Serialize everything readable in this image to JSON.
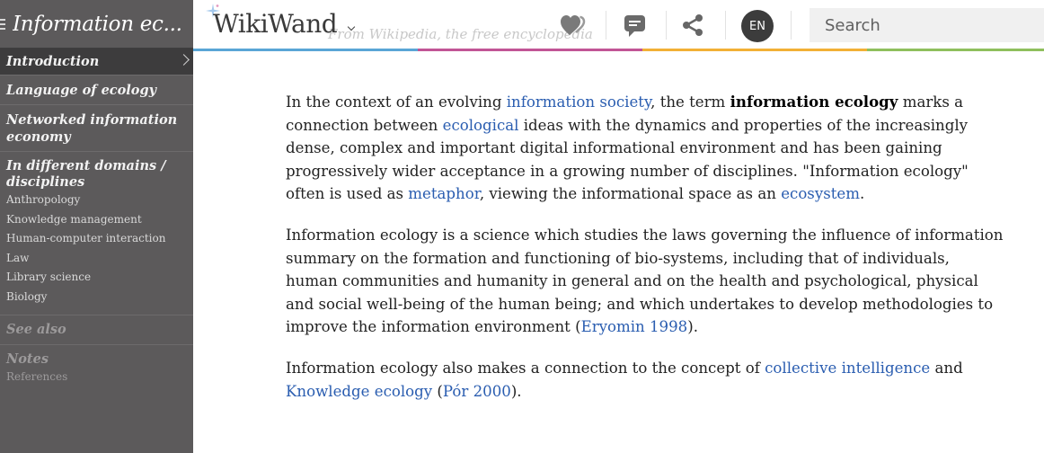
{
  "sidebar": {
    "title": "Information ec...",
    "active_item": "Introduction",
    "items": [
      "Language of ecology",
      "Networked information economy"
    ],
    "domains_section": {
      "heading": "In different domains / disciplines",
      "subitems": [
        "Anthropology",
        "Knowledge management",
        "Human-computer interaction",
        "Law",
        "Library science",
        "Biology"
      ]
    },
    "see_also": "See also",
    "notes": {
      "heading": "Notes",
      "subitems": [
        "References"
      ]
    }
  },
  "header": {
    "logo": "WikiWand",
    "tagline": "From Wikipedia, the free encyclopedia",
    "language": "EN",
    "search_placeholder": "Search",
    "icons": [
      "heart-icon",
      "comment-icon",
      "share-icon"
    ],
    "strip_colors": [
      "#5aa6d6",
      "#c15596",
      "#f2b036",
      "#8fbf5d"
    ]
  },
  "article": {
    "p1": {
      "t1": "In the context of an evolving ",
      "l1": "information society",
      "t2": ", the term ",
      "b1": "information ecology",
      "t3": " marks a connection between ",
      "l2": "ecological",
      "t4": " ideas with the dynamics and properties of the increasingly dense, complex and important digital informational environment and has been gaining progressively wider acceptance in a growing number of disciplines. \"Information ecology\" often is used as ",
      "l3": "metaphor",
      "t5": ", viewing the informational space as an ",
      "l4": "ecosystem",
      "t6": "."
    },
    "p2": {
      "t1": "Information ecology is a science which studies the laws governing the influence of information summary on the formation and functioning of bio-systems, including that of individuals, human communities and humanity in general and on the health and psychological, physical and social well-being of the human being; and which undertakes to develop methodologies to improve the information environment (",
      "l1": "Eryomin 1998",
      "t2": ")."
    },
    "p3": {
      "t1": "Information ecology also makes a connection to the concept of ",
      "l1": "collective intelligence",
      "t2": " and ",
      "l2": "Knowledge ecology",
      "t3": " (",
      "l3": "Pór 2000",
      "t4": ")."
    },
    "link_color": "#2a5db0"
  }
}
